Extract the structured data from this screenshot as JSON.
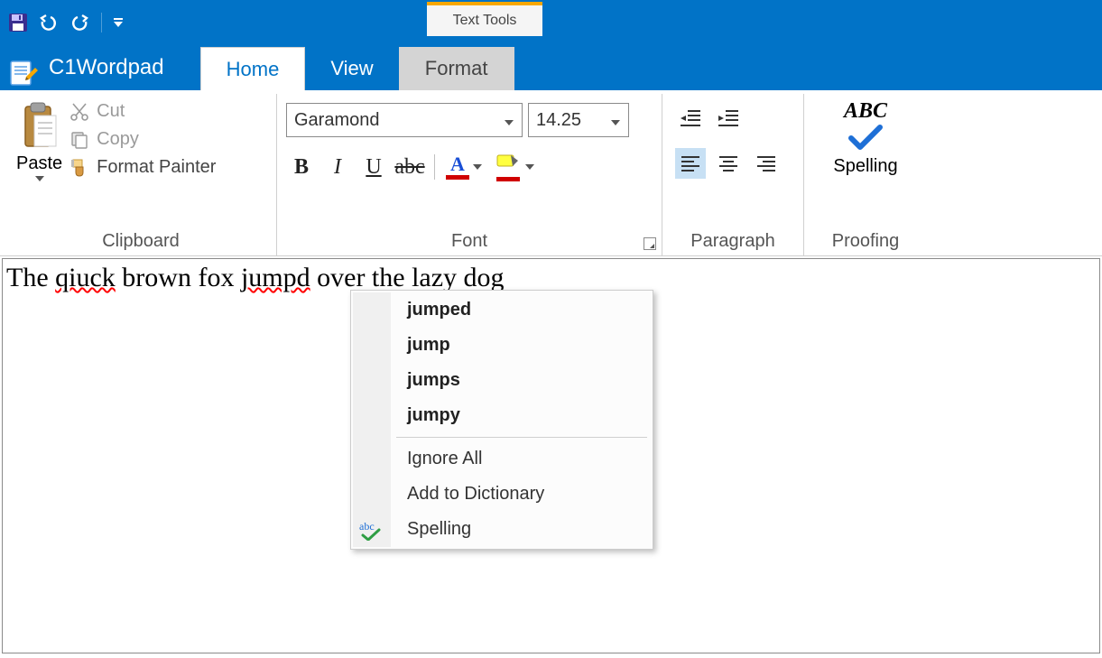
{
  "app": {
    "title": "C1Wordpad"
  },
  "context_tab": {
    "header": "Text Tools",
    "tab": "Format"
  },
  "tabs": {
    "home": "Home",
    "view": "View"
  },
  "ribbon": {
    "clipboard": {
      "label": "Clipboard",
      "paste": "Paste",
      "cut": "Cut",
      "copy": "Copy",
      "format_painter": "Format Painter"
    },
    "font": {
      "label": "Font",
      "family": "Garamond",
      "size": "14.25"
    },
    "paragraph": {
      "label": "Paragraph"
    },
    "proofing": {
      "label": "Proofing",
      "spelling": "Spelling",
      "abc": "ABC"
    }
  },
  "document": {
    "parts": {
      "p1": "The ",
      "err1": "qiuck",
      "p2": " brown fox ",
      "err2": "jumpd",
      "p3": " over the lazy dog"
    }
  },
  "context_menu": {
    "suggestions": [
      "jumped",
      "jump",
      "jumps",
      "jumpy"
    ],
    "ignore_all": "Ignore All",
    "add_to_dict": "Add to Dictionary",
    "spelling": "Spelling"
  }
}
